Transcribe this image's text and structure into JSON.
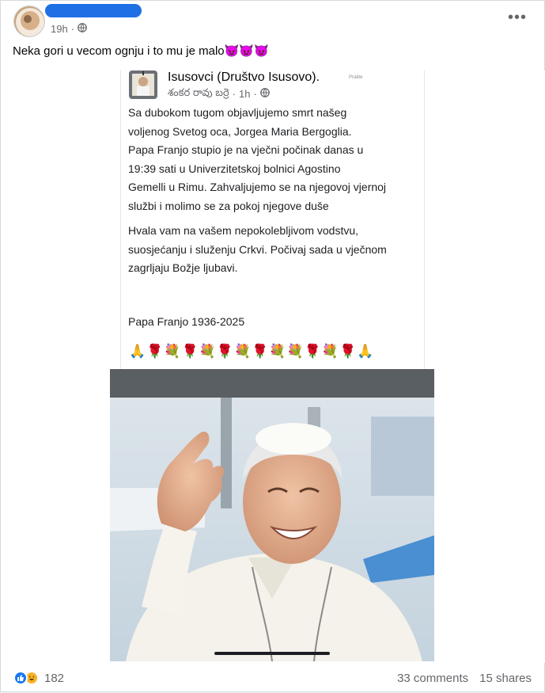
{
  "post": {
    "time": "19h",
    "privacy_icon": "globe-icon",
    "caption": "Neka gori u vecom ognju i to mu je malo😈😈😈"
  },
  "shared_post": {
    "page_name": "Isusovci (Društvo Isusovo).",
    "follow_label": "Pratite",
    "author": "శంకర రావు బర్రె",
    "time": "1h",
    "paragraph1_lines": [
      "Sa dubokom tugom objavljujemo smrt našeg",
      "voljenog Svetog oca, Jorgea Maria Bergoglia.",
      "Papa Franjo stupio je na vječni počinak danas u",
      "19:39 sati u Univerzitetskoj bolnici Agostino",
      "Gemelli u Rimu. Zahvaljujemo se na njegovoj vjernoj",
      "službi i molimo se za pokoj njegove duše"
    ],
    "paragraph2_lines": [
      "Hvala vam na vašem nepokolebljivom vodstvu,",
      "suosjećanju i služenju Crkvi. Počivaj sada u vječnom",
      "zagrljaju Božje ljubavi."
    ],
    "signature": "Papa Franjo 1936-2025",
    "emoji_row": "🙏🌹💐🌹💐🌹💐🌹💐💐🌹💐🌹🙏"
  },
  "footer": {
    "reaction_icons": [
      "like-icon",
      "haha-icon"
    ],
    "reaction_count": "182",
    "comments": "33 comments",
    "shares": "15 shares"
  },
  "colors": {
    "accent": "#1877f2",
    "redaction": "#1f6fe5",
    "secondary_text": "#65676b"
  }
}
